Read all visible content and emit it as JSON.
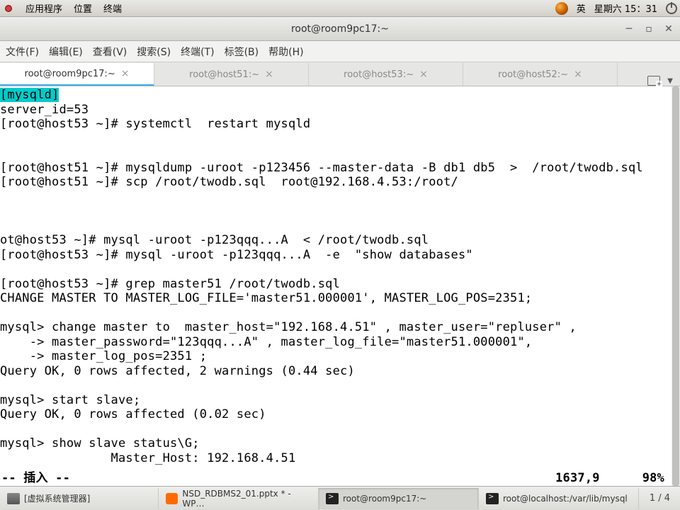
{
  "topbar": {
    "apps": "应用程序",
    "places": "位置",
    "terminal": "终端",
    "ime": "英",
    "date": "星期六 15：31"
  },
  "titlebar": {
    "title": "root@room9pc17:~"
  },
  "menubar": {
    "items": [
      "文件(F)",
      "编辑(E)",
      "查看(V)",
      "搜索(S)",
      "终端(T)",
      "标签(B)",
      "帮助(H)"
    ]
  },
  "tabs": [
    {
      "label": "root@room9pc17:~",
      "active": true
    },
    {
      "label": "root@host51:~",
      "active": false
    },
    {
      "label": "root@host53:~",
      "active": false
    },
    {
      "label": "root@host52:~",
      "active": false
    }
  ],
  "terminal": {
    "mysqld_tag": "[mysqld]",
    "lines": [
      "server_id=53",
      "[root@host53 ~]# systemctl  restart mysqld",
      "",
      "",
      "[root@host51 ~]# mysqldump -uroot -p123456 --master-data -B db1 db5  >  /root/twodb.sql",
      "[root@host51 ~]# scp /root/twodb.sql  root@192.168.4.53:/root/",
      "",
      "",
      "",
      "ot@host53 ~]# mysql -uroot -p123qqq...A  < /root/twodb.sql",
      "[root@host53 ~]# mysql -uroot -p123qqq...A  -e  \"show databases\"",
      "",
      "[root@host53 ~]# grep master51 /root/twodb.sql",
      "CHANGE MASTER TO MASTER_LOG_FILE='master51.000001', MASTER_LOG_POS=2351;",
      "",
      "mysql> change master to  master_host=\"192.168.4.51\" , master_user=\"repluser\" ,",
      "    -> master_password=\"123qqq...A\" , master_log_file=\"master51.000001\",",
      "    -> master_log_pos=2351 ;",
      "Query OK, 0 rows affected, 2 warnings (0.44 sec)",
      "",
      "mysql> start slave;",
      "Query OK, 0 rows affected (0.02 sec)",
      "",
      "mysql> show slave status\\G;",
      "               Master_Host: 192.168.4.51"
    ],
    "status": {
      "mode": "-- 插入 --",
      "pos": "1637,9",
      "pct": "98%"
    }
  },
  "taskbar": {
    "items": [
      {
        "label": "[虚拟系统管理器]",
        "icon": "vm"
      },
      {
        "label": "NSD_RDBMS2_01.pptx * - WP…",
        "icon": "wps"
      },
      {
        "label": "root@room9pc17:~",
        "icon": "term",
        "active": true
      },
      {
        "label": "root@localhost:/var/lib/mysql",
        "icon": "term"
      }
    ],
    "workspace": "1 / 4"
  }
}
